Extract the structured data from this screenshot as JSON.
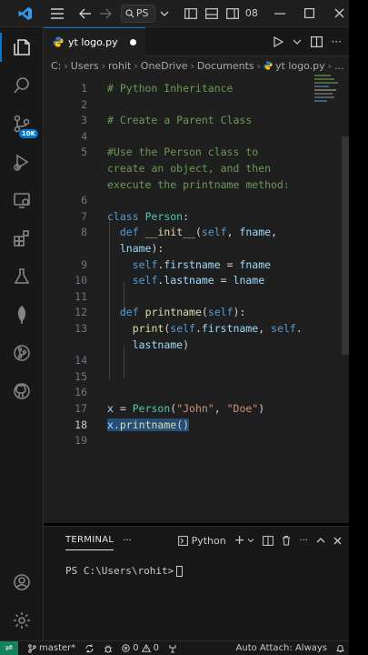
{
  "titlebar": {
    "search_text": "PS",
    "layout_text": "08"
  },
  "tab": {
    "filename": "yt logo.py"
  },
  "breadcrumb": [
    "C:",
    "Users",
    "rohit",
    "OneDrive",
    "Documents",
    "yt logo.py",
    "..."
  ],
  "activity": {
    "badge": "10K"
  },
  "code_lines": [
    {
      "n": "1",
      "html": "<span class='cmt'># Python Inheritance</span>"
    },
    {
      "n": "2",
      "html": ""
    },
    {
      "n": "3",
      "html": "<span class='cmt'># Create a Parent Class</span>"
    },
    {
      "n": "4",
      "html": ""
    },
    {
      "n": "5",
      "html": "<span class='cmt'>#Use the Person class to</span>"
    },
    {
      "n": "",
      "html": "<span class='cmt'>create an object, and then</span>"
    },
    {
      "n": "",
      "html": "<span class='cmt'>execute the printname method:</span>"
    },
    {
      "n": "6",
      "html": ""
    },
    {
      "n": "7",
      "html": "<span class='kw'>class</span> <span class='cls'>Person</span><span class='plain'>:</span>"
    },
    {
      "n": "8",
      "html": "  <span class='def'>def</span> <span class='fn'>__init__</span><span class='plain'>(</span><span class='self'>self</span><span class='plain'>, </span><span class='param'>fname</span><span class='plain'>,</span>"
    },
    {
      "n": "",
      "html": "  <span class='param'>lname</span><span class='plain'>):</span>"
    },
    {
      "n": "9",
      "html": "    <span class='self'>self</span><span class='plain'>.</span><span class='param'>firstname</span><span class='plain'> = </span><span class='param'>fname</span>"
    },
    {
      "n": "10",
      "html": "    <span class='self'>self</span><span class='plain'>.</span><span class='param'>lastname</span><span class='plain'> = </span><span class='param'>lname</span>"
    },
    {
      "n": "11",
      "html": ""
    },
    {
      "n": "12",
      "html": "  <span class='def'>def</span> <span class='fn'>printname</span><span class='plain'>(</span><span class='self'>self</span><span class='plain'>):</span>"
    },
    {
      "n": "13",
      "html": "    <span class='fn'>print</span><span class='plain'>(</span><span class='self'>self</span><span class='plain'>.</span><span class='param'>firstname</span><span class='plain'>, </span><span class='self'>self</span><span class='plain'>.</span>"
    },
    {
      "n": "",
      "html": "    <span class='param'>lastname</span><span class='plain'>)</span>"
    },
    {
      "n": "14",
      "html": ""
    },
    {
      "n": "15",
      "html": ""
    },
    {
      "n": "16",
      "html": ""
    },
    {
      "n": "17",
      "html": "<span class='param'>x</span><span class='plain'> = </span><span class='cls'>Person</span><span class='plain'>(</span><span class='str'>\"John\"</span><span class='plain'>, </span><span class='str'>\"Doe\"</span><span class='plain'>)</span>"
    },
    {
      "n": "18",
      "html": "<span class='sel'><span class='param'>x</span><span class='plain'>.</span><span class='fn'>printname</span><span class='plain'>()</span></span>",
      "current": true
    },
    {
      "n": "19",
      "html": ""
    }
  ],
  "panel": {
    "tab_label": "TERMINAL",
    "more": "···",
    "shell": "Python",
    "prompt": "PS C:\\Users\\rohit>"
  },
  "status": {
    "branch": "master*",
    "errors": "0",
    "warnings": "0",
    "auto_attach": "Auto Attach: Always"
  },
  "colors": {
    "accent": "#0078d4",
    "remote": "#16825d",
    "selection": "#264f78"
  }
}
